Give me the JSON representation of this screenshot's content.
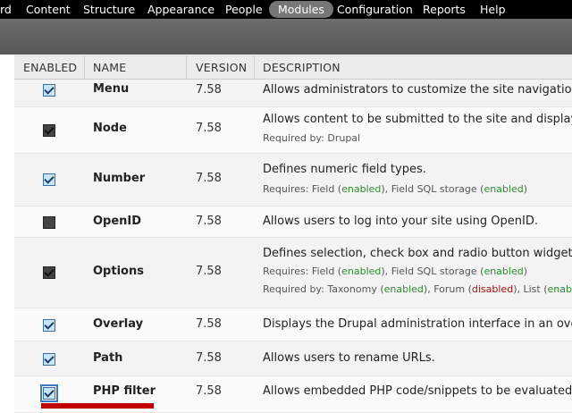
{
  "admin_menu": {
    "items": [
      {
        "label": "rd"
      },
      {
        "label": "Content"
      },
      {
        "label": "Structure"
      },
      {
        "label": "Appearance"
      },
      {
        "label": "People"
      },
      {
        "label": "Modules",
        "active": true
      },
      {
        "label": "Configuration"
      },
      {
        "label": "Reports"
      },
      {
        "label": "Help"
      }
    ]
  },
  "table": {
    "headers": {
      "enabled": "ENABLED",
      "name": "NAME",
      "version": "VERSION",
      "description": "DESCRIPTION"
    },
    "rows": [
      {
        "name": "Menu",
        "version": "7.58",
        "description": "Allows administrators to customize the site navigation me",
        "checked": true,
        "disabled": false
      },
      {
        "name": "Node",
        "version": "7.58",
        "description": "Allows content to be submitted to the site and displayed",
        "checked": true,
        "disabled": true,
        "required_by_label": "Required by:",
        "required_by": "Drupal"
      },
      {
        "name": "Number",
        "version": "7.58",
        "description": "Defines numeric field types.",
        "checked": true,
        "disabled": false,
        "requires_label": "Requires:",
        "requires": [
          {
            "name": "Field",
            "status": "enabled"
          },
          {
            "name": "Field SQL storage",
            "status": "enabled"
          }
        ]
      },
      {
        "name": "OpenID",
        "version": "7.58",
        "description": "Allows users to log into your site using OpenID.",
        "checked": false,
        "disabled": true
      },
      {
        "name": "Options",
        "version": "7.58",
        "description": "Defines selection, check box and radio button widgets for",
        "checked": true,
        "disabled": true,
        "requires_label": "Requires:",
        "requires": [
          {
            "name": "Field",
            "status": "enabled"
          },
          {
            "name": "Field SQL storage",
            "status": "enabled"
          }
        ],
        "required_by_label": "Required by:",
        "required_by_list": [
          {
            "name": "Taxonomy",
            "status": "enabled"
          },
          {
            "name": "Forum",
            "status": "disabled"
          },
          {
            "name": "List",
            "status": "enabl"
          }
        ]
      },
      {
        "name": "Overlay",
        "version": "7.58",
        "description": "Displays the Drupal administration interface in an overlay.",
        "checked": true,
        "disabled": false
      },
      {
        "name": "Path",
        "version": "7.58",
        "description": "Allows users to rename URLs.",
        "checked": true,
        "disabled": false
      },
      {
        "name": "PHP filter",
        "version": "7.58",
        "description": "Allows embedded PHP code/snippets to be evaluated.",
        "checked": true,
        "disabled": false,
        "focused": true
      }
    ]
  },
  "colors": {
    "enabled": "#2c8c2c",
    "disabled": "#a01010",
    "highlight_marker": "#c00000"
  }
}
